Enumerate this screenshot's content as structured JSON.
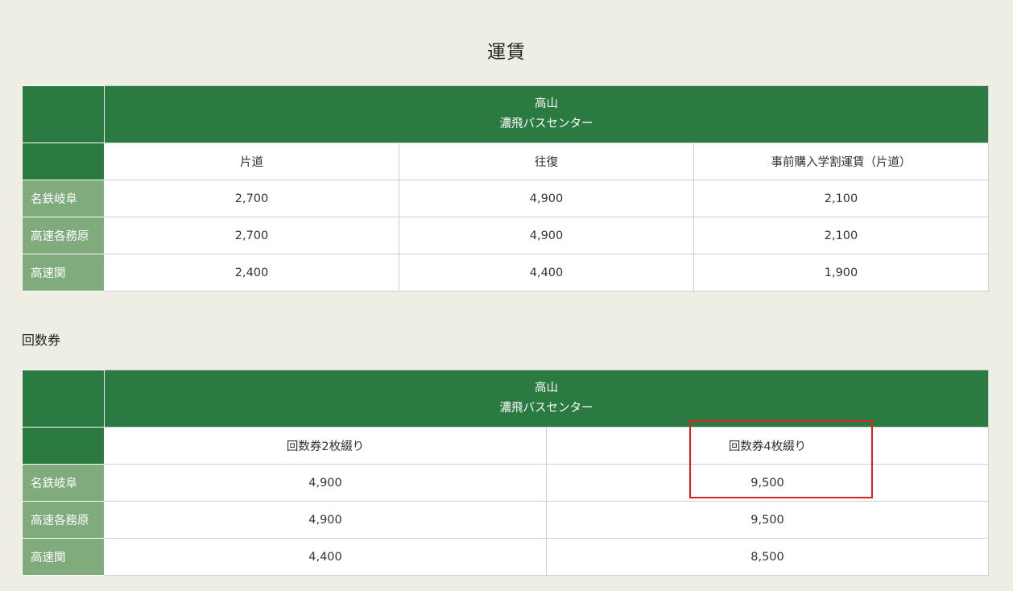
{
  "page_title": "運賃",
  "fare_table": {
    "destination_line1": "高山",
    "destination_line2": "濃飛バスセンター",
    "columns": [
      "片道",
      "往復",
      "事前購入学割運賃（片道）"
    ],
    "rows": [
      {
        "label": "名鉄岐阜",
        "values": [
          "2,700",
          "4,900",
          "2,100"
        ]
      },
      {
        "label": "高速各務原",
        "values": [
          "2,700",
          "4,900",
          "2,100"
        ]
      },
      {
        "label": "高速関",
        "values": [
          "2,400",
          "4,400",
          "1,900"
        ]
      }
    ]
  },
  "coupon_section_label": "回数券",
  "coupon_table": {
    "destination_line1": "高山",
    "destination_line2": "濃飛バスセンター",
    "columns": [
      "回数券2枚綴り",
      "回数券4枚綴り"
    ],
    "rows": [
      {
        "label": "名鉄岐阜",
        "values": [
          "4,900",
          "9,500"
        ]
      },
      {
        "label": "高速各務原",
        "values": [
          "4,900",
          "9,500"
        ]
      },
      {
        "label": "高速関",
        "values": [
          "4,400",
          "8,500"
        ]
      }
    ]
  },
  "colors": {
    "background": "#efeee4",
    "header_green": "#2b7a41",
    "row_label_green": "#80ab7d",
    "highlight_red": "#e02020"
  }
}
